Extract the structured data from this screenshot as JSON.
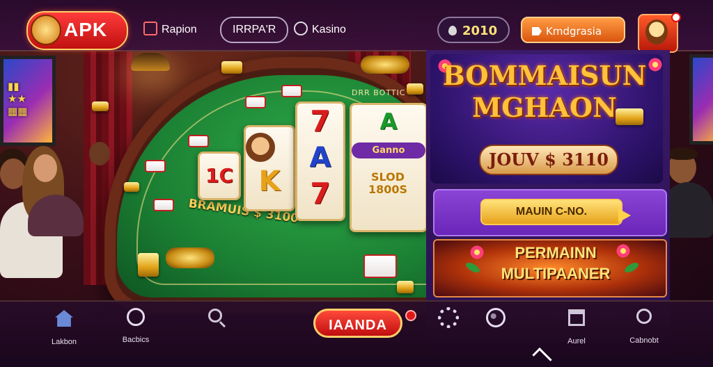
{
  "header": {
    "logo_text": "APK",
    "nav": [
      {
        "label": "Rapion",
        "icon": "slot-machine-icon"
      },
      {
        "label": "IRRPA'R",
        "icon": ""
      },
      {
        "label": "Kasino",
        "icon": "casino-chip-icon"
      }
    ],
    "coins": "2010",
    "action_label": "Kmdgrasia",
    "profile_icon": "character-avatar-icon"
  },
  "table": {
    "felt_top_text": "DRR BOTTIC",
    "felt_bottom_text": "BRAMUIS $ 3100",
    "reels": [
      {
        "symbol": "1C",
        "style": "red"
      },
      {
        "symbol": "K",
        "style": "gold-k"
      },
      {
        "symbol": "7",
        "style": "red"
      },
      {
        "symbol": "A",
        "style": "blue"
      },
      {
        "symbol": "7",
        "style": "red"
      },
      {
        "symbol": "A",
        "style": "green"
      },
      {
        "badge": "Ganno"
      },
      {
        "text": "SLOD 1800S"
      }
    ]
  },
  "promo": {
    "banner1_title": "BOMMAISUN MGHAON",
    "banner1_button": "JOUV $ 3110",
    "banner2_button": "MAUIN C-NO.",
    "banner3_title": "PERMAINN MULTIPAANER"
  },
  "bottom_nav": {
    "items": [
      {
        "label": "Lakbon",
        "icon": "home-icon"
      },
      {
        "label": "Bacbics",
        "icon": "ring-icon"
      },
      {
        "label": "",
        "icon": "search-icon"
      },
      {
        "label": "",
        "icon": "gear-icon"
      },
      {
        "label": "",
        "icon": "globe-icon"
      },
      {
        "label": "Aurel",
        "icon": "box-icon"
      },
      {
        "label": "Cabnobt",
        "icon": "tool-icon"
      }
    ],
    "center_button": "IAANDA"
  },
  "colors": {
    "accent_red": "#e01818",
    "gold": "#ffc23a",
    "purple_panel": "#3a1a6a",
    "felt_green": "#1b7f33"
  }
}
